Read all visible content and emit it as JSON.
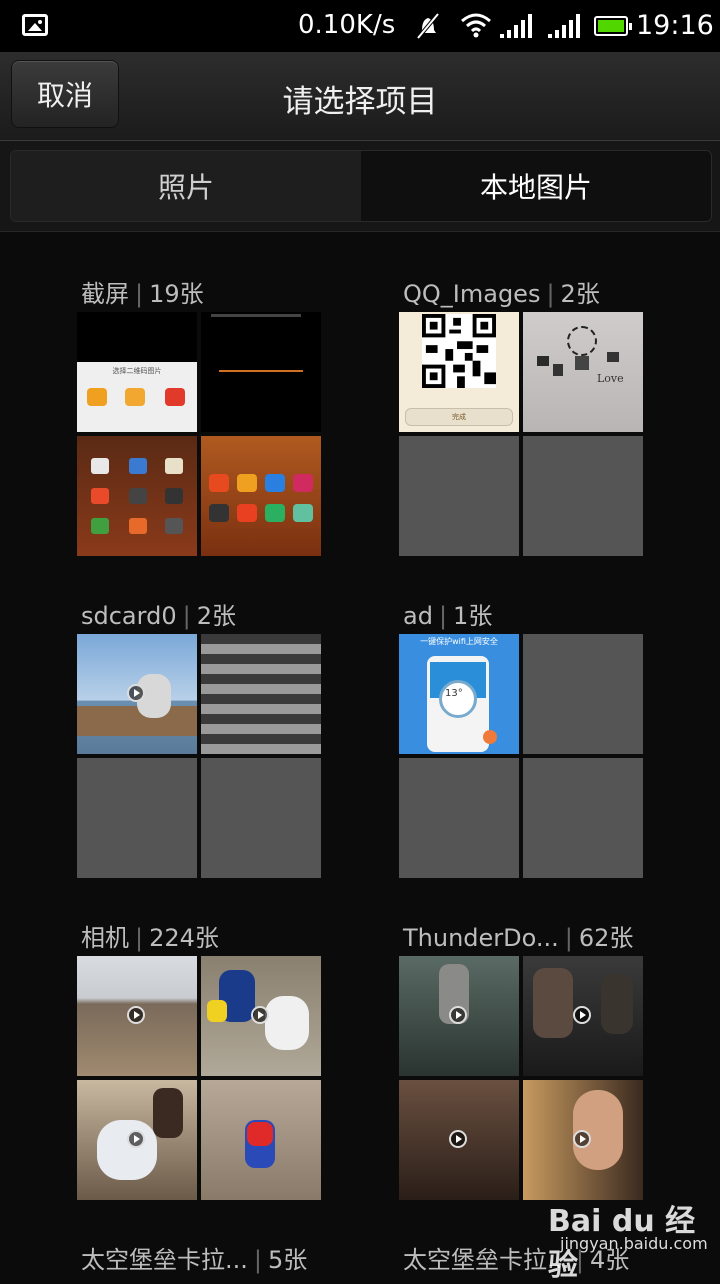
{
  "status_bar": {
    "speed": "0.10K/s",
    "time": "19:16",
    "notif_icon": "image-icon",
    "mute_icon": "mute-icon",
    "wifi_icon": "wifi-icon",
    "signal_icon": "signal-icon",
    "battery_color": "#52d600"
  },
  "header": {
    "cancel_label": "取消",
    "title": "请选择项目"
  },
  "tabs": [
    {
      "label": "照片"
    },
    {
      "label": "本地图片"
    }
  ],
  "albums": [
    {
      "name": "截屏",
      "count": "19张"
    },
    {
      "name": "QQ_Images",
      "count": "2张"
    },
    {
      "name": "sdcard0",
      "count": "2张"
    },
    {
      "name": "ad",
      "count": "1张"
    },
    {
      "name": "相机",
      "count": "224张"
    },
    {
      "name": "ThunderDo...",
      "count": "62张"
    },
    {
      "name": "太空堡垒卡拉...",
      "count": "5张"
    },
    {
      "name": "太空堡垒卡拉...",
      "count": "4张"
    }
  ],
  "thumb_texts": {
    "screenshot_dialog": "选择二维码图片",
    "poster_text": "Love",
    "ad_text": "一键保护wifi上网安全",
    "ad_temp": "13°",
    "qr_button": "完成"
  },
  "watermark": {
    "brand": "Bai du 经验",
    "url": "jingyan.baidu.com"
  }
}
